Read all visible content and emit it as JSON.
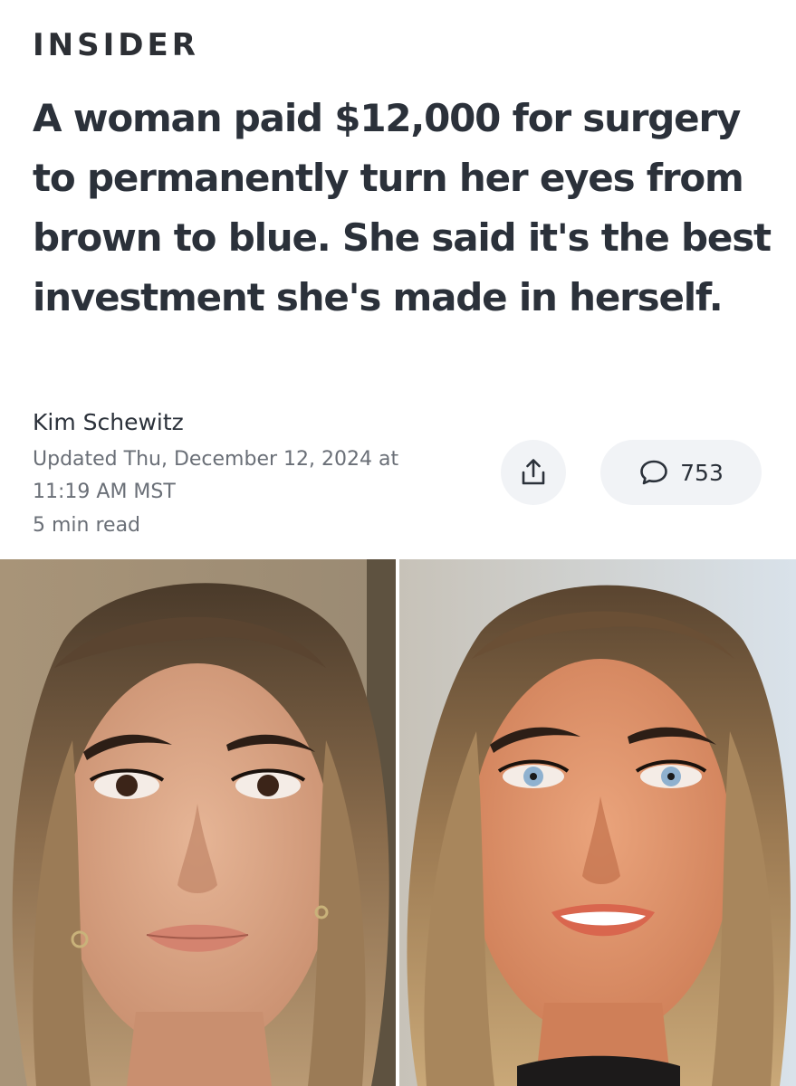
{
  "header": {
    "brand": "INSIDER"
  },
  "article": {
    "headline": "A woman paid $12,000 for surgery to permanently turn her eyes from brown to blue. She said it's the best investment she's made in herself.",
    "author": "Kim Schewitz",
    "updated": "Updated Thu, December 12, 2024 at 11:19 AM MST",
    "read_time": "5 min read"
  },
  "actions": {
    "share_icon": "share-icon",
    "comment_icon": "comment-icon",
    "comment_count": "753"
  },
  "photos": {
    "before": {
      "description_icon": "portrait-brown-eyes",
      "eye_color": "#3b2418"
    },
    "after": {
      "description_icon": "portrait-blue-eyes",
      "eye_color": "#8fb1cf"
    }
  },
  "colors": {
    "text": "#2b313a",
    "muted": "#6a6f77",
    "button_bg": "#f1f3f6"
  }
}
